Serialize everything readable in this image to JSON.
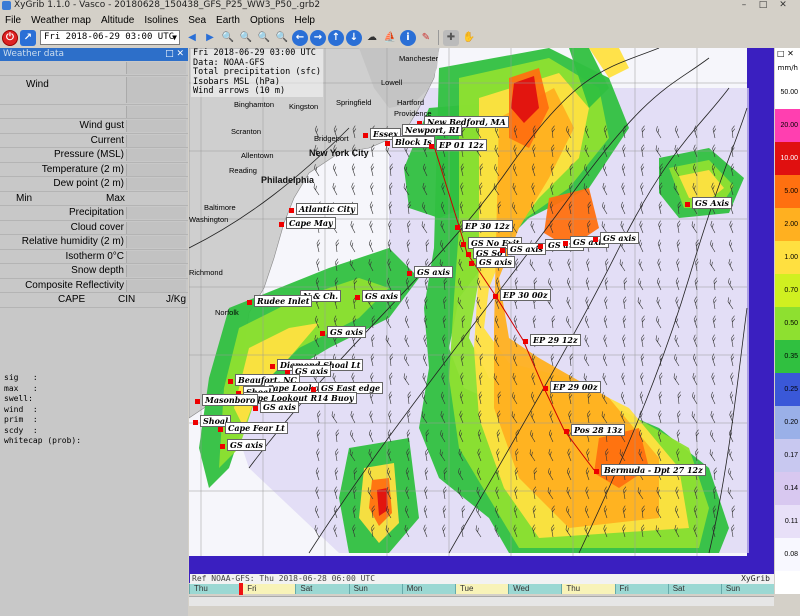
{
  "window": {
    "title": "XyGrib 1.1.0 - Vasco - 20180628_150438_GFS_P25_WW3_P50_.grb2"
  },
  "menu": [
    "File",
    "Weather map",
    "Altitude",
    "Isolines",
    "Sea",
    "Earth",
    "Options",
    "Help"
  ],
  "toolbar": {
    "date_value": "Fri 2018-06-29 03:00 UTC"
  },
  "left_panel": {
    "title": "Weather data",
    "rows": [
      {
        "label": ""
      },
      {
        "label": "Wind"
      },
      {
        "label": ""
      },
      {
        "label": "Wind gust"
      },
      {
        "label": "Current"
      },
      {
        "label": "Pressure (MSL)"
      },
      {
        "label": "Temperature (2 m)"
      },
      {
        "label": "Dew point (2 m)"
      },
      {
        "label": "Min",
        "right": "Max"
      },
      {
        "label": "Precipitation"
      },
      {
        "label": "Cloud cover"
      },
      {
        "label": "Relative humidity (2 m)"
      },
      {
        "label": "Isotherm 0°C"
      },
      {
        "label": "Snow depth"
      },
      {
        "label": "Composite Reflectivity"
      },
      {
        "label": "CAPE",
        "mid": "CIN",
        "right": "J/Kg"
      }
    ],
    "wave_info": "sig   :\nmax   :\nswell:\nwind  :\nprim  :\nscdy  :\nwhitecap (prob):"
  },
  "map": {
    "info_lines": "Fri 2018-06-29 03:00 UTC\nData: NOAA-GFS\nTotal precipitation (sfc)\nIsobars MSL (hPa)\nWind arrows (10 m)",
    "cities": [
      {
        "name": "Manchester",
        "big": false
      },
      {
        "name": "Lowell",
        "big": false
      },
      {
        "name": "Springfield",
        "big": false
      },
      {
        "name": "Hartford",
        "big": false
      },
      {
        "name": "Providence",
        "big": false
      },
      {
        "name": "Bridgeport",
        "big": false
      },
      {
        "name": "New York City",
        "big": true
      },
      {
        "name": "Philadelphia",
        "big": true
      },
      {
        "name": "Baltimore",
        "big": false
      },
      {
        "name": "Washington",
        "big": false
      },
      {
        "name": "Richmond",
        "big": false
      },
      {
        "name": "Reading",
        "big": false
      },
      {
        "name": "Kingston",
        "big": false
      },
      {
        "name": "Binghamton",
        "big": false
      },
      {
        "name": "Scranton",
        "big": false
      },
      {
        "name": "Allentown",
        "big": false
      },
      {
        "name": "Norfolk",
        "big": false
      }
    ],
    "pins": [
      {
        "label": "New Bedford, MA"
      },
      {
        "label": "Newport, RI"
      },
      {
        "label": "Essex"
      },
      {
        "label": "Block Is"
      },
      {
        "label": "EP 01 12z"
      },
      {
        "label": "Atlantic City"
      },
      {
        "label": "Cape May"
      },
      {
        "label": "EP 30 12z"
      },
      {
        "label": "GS No Exit"
      },
      {
        "label": "GS So"
      },
      {
        "label": "GS axis"
      },
      {
        "label": "GS axis"
      },
      {
        "label": "GS axis"
      },
      {
        "label": "GS axis"
      },
      {
        "label": "GS axis"
      },
      {
        "label": "GS axis"
      },
      {
        "label": "GS Axis"
      },
      {
        "label": "EP 30 00z"
      },
      {
        "label": "N & Ch."
      },
      {
        "label": "Rudee Inlet"
      },
      {
        "label": "GS axis"
      },
      {
        "label": "GS axis"
      },
      {
        "label": "EP 29 12z"
      },
      {
        "label": "Diamond Shoal Lt"
      },
      {
        "label": "GS axis"
      },
      {
        "label": "Beaufort, NC"
      },
      {
        "label": "Cape Lookout"
      },
      {
        "label": "GS East edge"
      },
      {
        "label": "Shoal"
      },
      {
        "label": "Cape Lookout R14 Buoy"
      },
      {
        "label": "EP 29 00z"
      },
      {
        "label": "Masonboro"
      },
      {
        "label": "GS axis"
      },
      {
        "label": "Shoal"
      },
      {
        "label": "Cape Fear Lt"
      },
      {
        "label": "GS axis"
      },
      {
        "label": "Pos 28 13z"
      },
      {
        "label": "Bermuda - Dpt 27 12z"
      }
    ],
    "ref_text": "Ref NOAA-GFS: Thu 2018-06-28 06:00 UTC",
    "brand": "XyGrib"
  },
  "timeline": {
    "days": [
      "Thu",
      "Fri",
      "Sat",
      "Sun",
      "Mon",
      "Tue",
      "Wed",
      "Thu",
      "Fri",
      "Sat",
      "Sun"
    ],
    "highlighted": [
      1,
      5,
      7
    ]
  },
  "color_scale": {
    "unit": "mm/h",
    "labels": [
      "50.00",
      "20.00",
      "10.00",
      "5.00",
      "2.00",
      "1.00",
      "0.70",
      "0.50",
      "0.35",
      "0.25",
      "0.20",
      "0.17",
      "0.14",
      "0.11",
      "0.08"
    ],
    "colors": [
      "#ffffff",
      "#ff3fb0",
      "#e01010",
      "#ff7010",
      "#ffb020",
      "#ffe040",
      "#d0f020",
      "#8ee030",
      "#30c040",
      "#3a58d8",
      "#9ab0e8",
      "#c8c8f0",
      "#d8c8f0",
      "#e8e0f8",
      "#f8f8ff"
    ]
  }
}
